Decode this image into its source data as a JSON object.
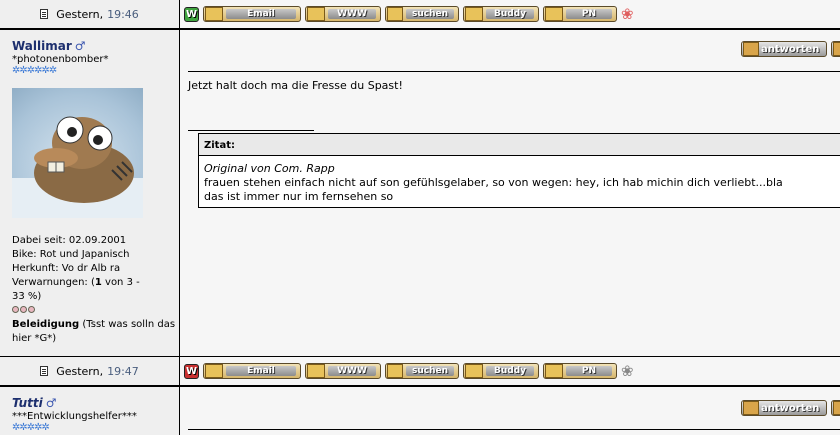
{
  "posts": [
    {
      "date": "Gestern,",
      "time": "19:46",
      "buttons": [
        "Email",
        "WWW",
        "suchen",
        "Buddy",
        "PN"
      ],
      "w_badge": "W"
    },
    {
      "username": "Wallimar",
      "gender_symbol": "♂",
      "rank": "*photonenbomber*",
      "stars": "✲✲✲✲✲✲",
      "info": {
        "dabei": "Dabei seit: 02.09.2001",
        "bike": "Bike: Rot und Japanisch",
        "herkunft": "Herkunft: Vo dr Alb ra",
        "verwarnungen_prefix": "Verwarnungen: (",
        "verwarnungen_count": "1",
        "verwarnungen_suffix": " von 3 -",
        "verwarnungen_percent": "33 %)",
        "beleidigung": "Beleidigung",
        "beleidigung_note": "(Tsst was solln das hier *G*)"
      },
      "reply_label": "antworten",
      "message": "Jetzt halt doch ma die Fresse du Spast!",
      "quote": {
        "header": "Zitat:",
        "original": "Original von Com. Rapp",
        "line1": "frauen stehen einfach nicht auf son gefühlsgelaber, so von wegen: hey, ich hab michin dich verliebt...bla",
        "line2": "das ist immer nur im fernsehen so"
      },
      "date": "Gestern,",
      "time": "19:47",
      "buttons": [
        "Email",
        "WWW",
        "suchen",
        "Buddy",
        "PN"
      ],
      "w_badge": "W"
    },
    {
      "username": "Tutti",
      "gender_symbol": "♂",
      "rank": "***Entwicklungshelfer***",
      "stars": "✲✲✲✲✲",
      "reply_label": "antworten"
    }
  ],
  "colors": {
    "username": "#1d2f6e",
    "time": "#4a5e7e",
    "stars": "#3c7ad6",
    "w_green": "#3fa33f",
    "w_red": "#c83030"
  },
  "icons": [
    "document-icon",
    "email-icon",
    "www-icon",
    "search-icon",
    "buddy-icon",
    "pm-icon",
    "flower-icon",
    "reply-icon"
  ]
}
